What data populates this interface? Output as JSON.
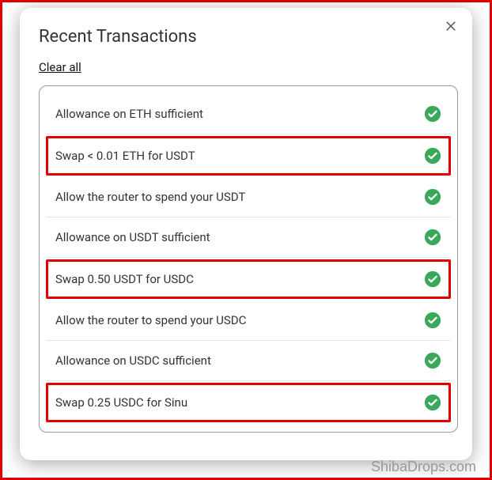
{
  "modal": {
    "title": "Recent Transactions",
    "clear_all": "Clear all"
  },
  "transactions": [
    {
      "label": "Allowance on ETH sufficient",
      "status": "success",
      "highlight": false
    },
    {
      "label": "Swap < 0.01 ETH for USDT",
      "status": "success",
      "highlight": true
    },
    {
      "label": "Allow the router to spend your USDT",
      "status": "success",
      "highlight": false
    },
    {
      "label": "Allowance on USDT sufficient",
      "status": "success",
      "highlight": false
    },
    {
      "label": "Swap 0.50 USDT for USDC",
      "status": "success",
      "highlight": true
    },
    {
      "label": "Allow the router to spend your USDC",
      "status": "success",
      "highlight": false
    },
    {
      "label": "Allowance on USDC sufficient",
      "status": "success",
      "highlight": false
    },
    {
      "label": "Swap 0.25 USDC for Sinu",
      "status": "success",
      "highlight": true
    }
  ],
  "watermark": "ShibaDrops.com",
  "colors": {
    "highlight_border": "#e20000",
    "success_badge": "#39a85b"
  }
}
